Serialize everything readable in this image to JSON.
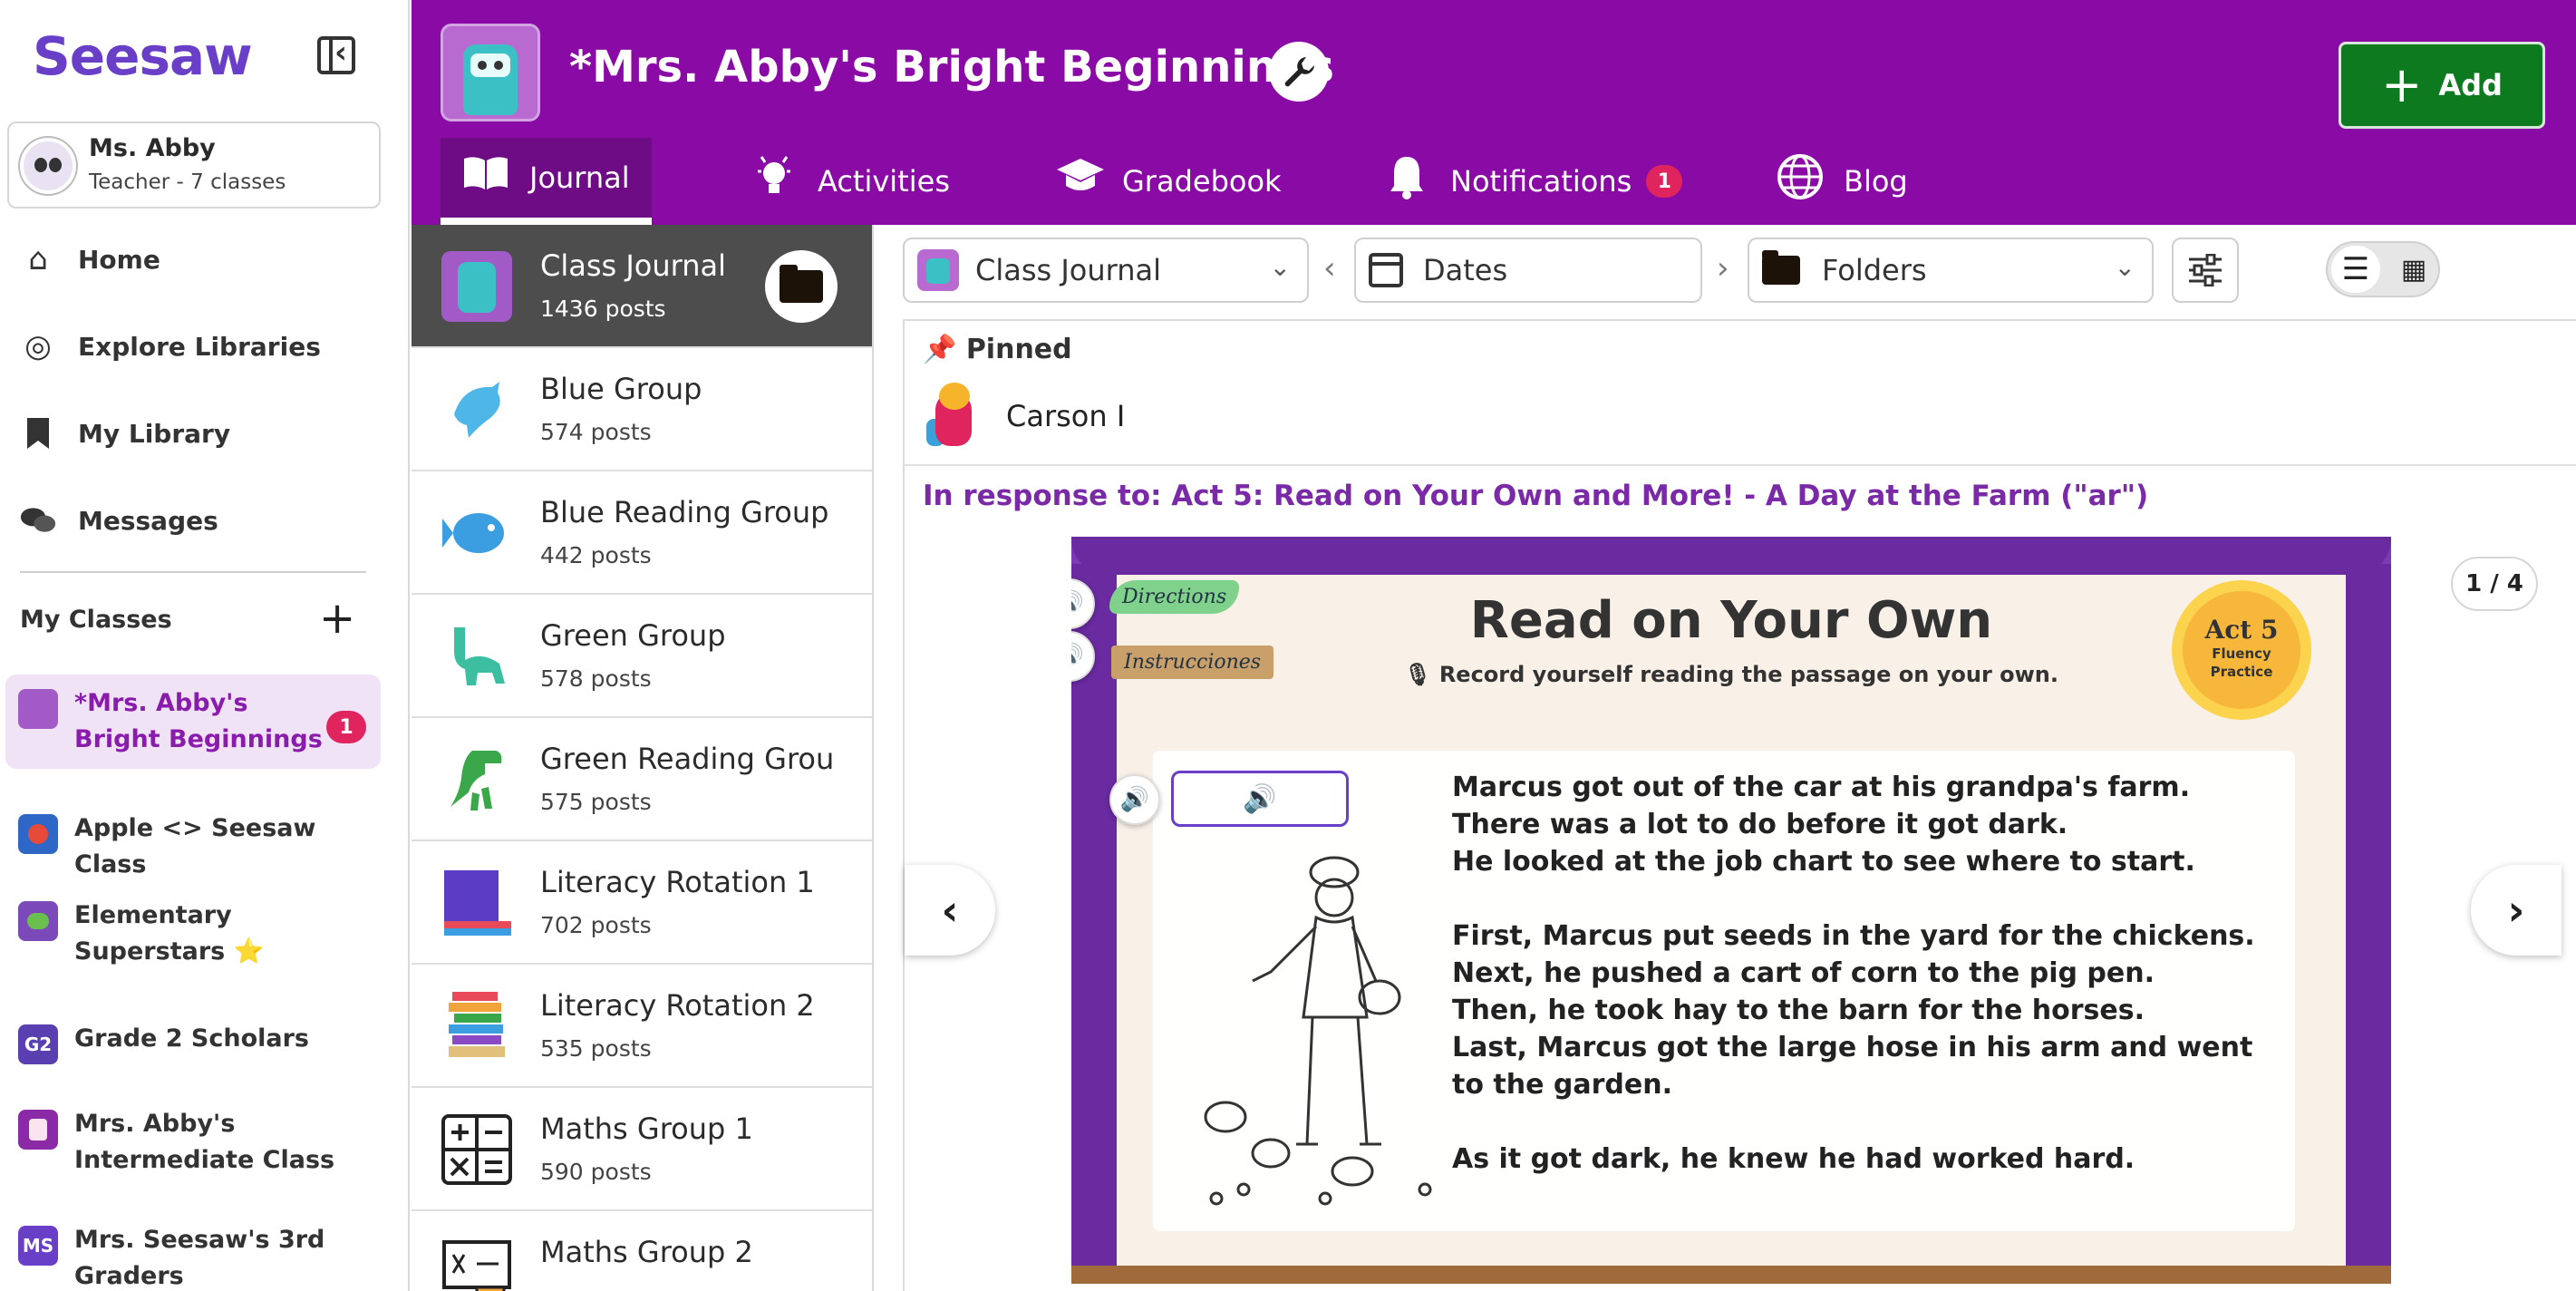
{
  "sidebar": {
    "logo": "Seesaw",
    "user": {
      "name": "Ms. Abby",
      "role": "Teacher - 7 classes"
    },
    "nav": [
      {
        "label": "Home",
        "icon": "home-icon"
      },
      {
        "label": "Explore Libraries",
        "icon": "compass-icon"
      },
      {
        "label": "My Library",
        "icon": "bookmark-icon"
      },
      {
        "label": "Messages",
        "icon": "chat-icon"
      }
    ],
    "section_title": "My Classes",
    "classes": [
      {
        "name": "*Mrs. Abby's Bright Beginnings",
        "badge": "1",
        "avatar": "",
        "color": "#a25ac7"
      },
      {
        "name": "Apple <> Seesaw Class",
        "avatar": "",
        "color": "#2e67c6"
      },
      {
        "name": "Elementary Superstars ⭐",
        "avatar": "",
        "color": "#7c4ab8"
      },
      {
        "name": "Grade 2 Scholars",
        "avatar": "G2",
        "color": "#5a3fb0"
      },
      {
        "name": "Mrs. Abby's Intermediate Class",
        "avatar": "",
        "color": "#8a2aa6"
      },
      {
        "name": "Mrs. Seesaw's 3rd Graders",
        "avatar": "MS",
        "color": "#6a3fc8"
      }
    ]
  },
  "header": {
    "title": "*Mrs. Abby's Bright Beginnings",
    "add_label": "Add",
    "tabs": [
      {
        "label": "Journal",
        "icon": "book-icon"
      },
      {
        "label": "Activities",
        "icon": "lightbulb-icon"
      },
      {
        "label": "Gradebook",
        "icon": "graduation-cap-icon"
      },
      {
        "label": "Notifications",
        "icon": "bell-icon",
        "badge": "1"
      },
      {
        "label": "Blog",
        "icon": "globe-icon"
      }
    ]
  },
  "groups": [
    {
      "name": "Class Journal",
      "posts": "1436 posts",
      "icon": "robot-icon"
    },
    {
      "name": "Blue Group",
      "posts": "574 posts",
      "icon": "dolphin-icon"
    },
    {
      "name": "Blue Reading Group",
      "posts": "442 posts",
      "icon": "fish-icon"
    },
    {
      "name": "Green Group",
      "posts": "578 posts",
      "icon": "dinosaur-icon"
    },
    {
      "name": "Green Reading Grou",
      "posts": "575 posts",
      "icon": "t-rex-icon"
    },
    {
      "name": "Literacy Rotation 1",
      "posts": "702 posts",
      "icon": "books-icon"
    },
    {
      "name": "Literacy Rotation 2",
      "posts": "535 posts",
      "icon": "book-stack-icon"
    },
    {
      "name": "Maths Group 1",
      "posts": "590 posts",
      "icon": "math-symbols-icon"
    },
    {
      "name": "Maths Group 2",
      "posts": "",
      "icon": "chalkboard-icon"
    }
  ],
  "filters": {
    "class_select": "Class Journal",
    "dates": "Dates",
    "folders": "Folders"
  },
  "post": {
    "pinned_label": "Pinned",
    "author": "Carson I",
    "response": "In response to: Act 5: Read on Your Own and More! - A Day at the Farm (\"ar\")",
    "page_counter": "1 / 4"
  },
  "slide": {
    "title": "Read on Your Own",
    "subtitle": "🎙 Record yourself reading the passage on your own.",
    "tag_directions": "Directions",
    "tag_instrucciones": "Instrucciones",
    "badge_act": "Act 5",
    "badge_sub": "Fluency Practice",
    "passage": [
      "Marcus got out of the car at his grandpa's farm.",
      "There was a lot to do before it got dark.",
      "He looked at the job chart to see where to start.",
      "First, Marcus put seeds in the yard for the chickens.",
      "Next, he pushed a cart of corn to the pig pen.",
      "Then, he took hay to the barn for the horses.",
      "Last, Marcus got the large hose in his arm and went to the garden.",
      "As it got dark, he knew he had worked hard."
    ]
  },
  "colors": {
    "header_purple": "#8a0aa6",
    "add_green": "#0e7a1f",
    "badge_red": "#e0245e",
    "link_purple": "#7a2aa6"
  }
}
